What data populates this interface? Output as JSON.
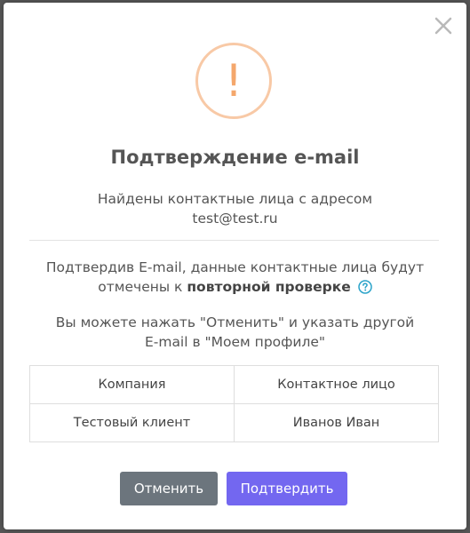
{
  "dialog": {
    "title": "Подтверждение e-mail",
    "warning_icon_glyph": "!",
    "warning_color": "#f4a76c",
    "found_line1": "Найдены контактные лица с адресом",
    "found_email": "test@test.ru",
    "confirm_line1": "Подтвердив E-mail, данные контактные лица будут",
    "confirm_line2_prefix": "отмечены к",
    "confirm_line2_bold": "повторной проверке",
    "cancel_hint_line1": "Вы можете нажать \"Отменить\" и указать другой",
    "cancel_hint_line2": "E-mail в \"Моем профиле\""
  },
  "table": {
    "headers": [
      "Компания",
      "Контактное лицо"
    ],
    "rows": [
      [
        "Тестовый клиент",
        "Иванов Иван"
      ]
    ]
  },
  "buttons": {
    "cancel_label": "Отменить",
    "confirm_label": "Подтвердить",
    "cancel_color": "#6c757d",
    "confirm_color": "#7367f0"
  },
  "icons": {
    "close": "close-icon",
    "warning": "warning-icon",
    "help": "question-circle-icon"
  }
}
